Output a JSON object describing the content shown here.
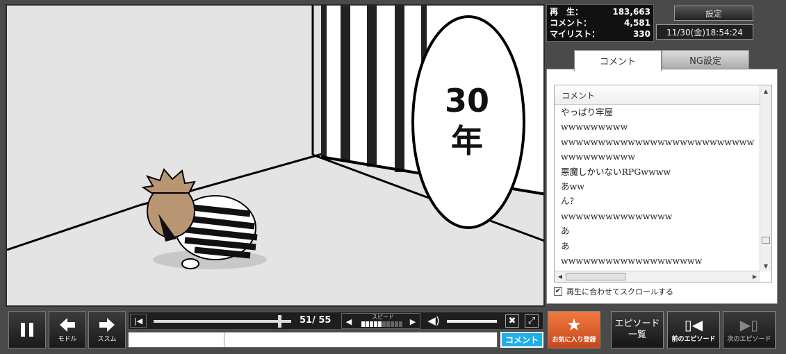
{
  "stats": {
    "views_label": "再　生：",
    "views": "183,663",
    "comments_label": "コメント：",
    "comments": "4,581",
    "mylist_label": "マイリスト：",
    "mylist": "330"
  },
  "header": {
    "settings_label": "設定",
    "datetime": "11/30(金)18:54:24"
  },
  "video": {
    "bubble_text_1": "30",
    "bubble_text_2": "年"
  },
  "comment_panel": {
    "tabs": [
      {
        "label": "コメント",
        "active": true
      },
      {
        "label": "NG設定",
        "active": false
      }
    ],
    "column_header": "コメント",
    "rows": [
      "やっぱり牢屋",
      "wwwwwwwww",
      "wwwwwwwwwwwwwwwwwwwwwwwwww",
      "wwwwwwwwww",
      "悪魔しかいないRPGwwww",
      "あww",
      "ん？",
      "wwwwwwwwwwwwwww",
      "あ",
      "あ",
      "wwwwwwwwwwwwwwwwwww"
    ],
    "sync_scroll_label": "再生に合わせてスクロールする",
    "sync_scroll_checked": true
  },
  "controls": {
    "back_label": "モドル",
    "forward_label": "ススム",
    "time_current": "51",
    "time_total": "55",
    "speed_label": "スピード",
    "speed_level": 0.5,
    "comment_send_label": "コメント",
    "comment_command": "",
    "comment_text": ""
  },
  "actions": {
    "favorite_label": "お気に入り登録",
    "episode_list_label_1": "エピソード",
    "episode_list_label_2": "一覧",
    "prev_episode_label": "前のエピソード",
    "next_episode_label": "次のエピソード"
  },
  "colors": {
    "comment_button": "#1fb0e8",
    "favorite_button": "#e0622c",
    "background": "#4a4a4a"
  }
}
